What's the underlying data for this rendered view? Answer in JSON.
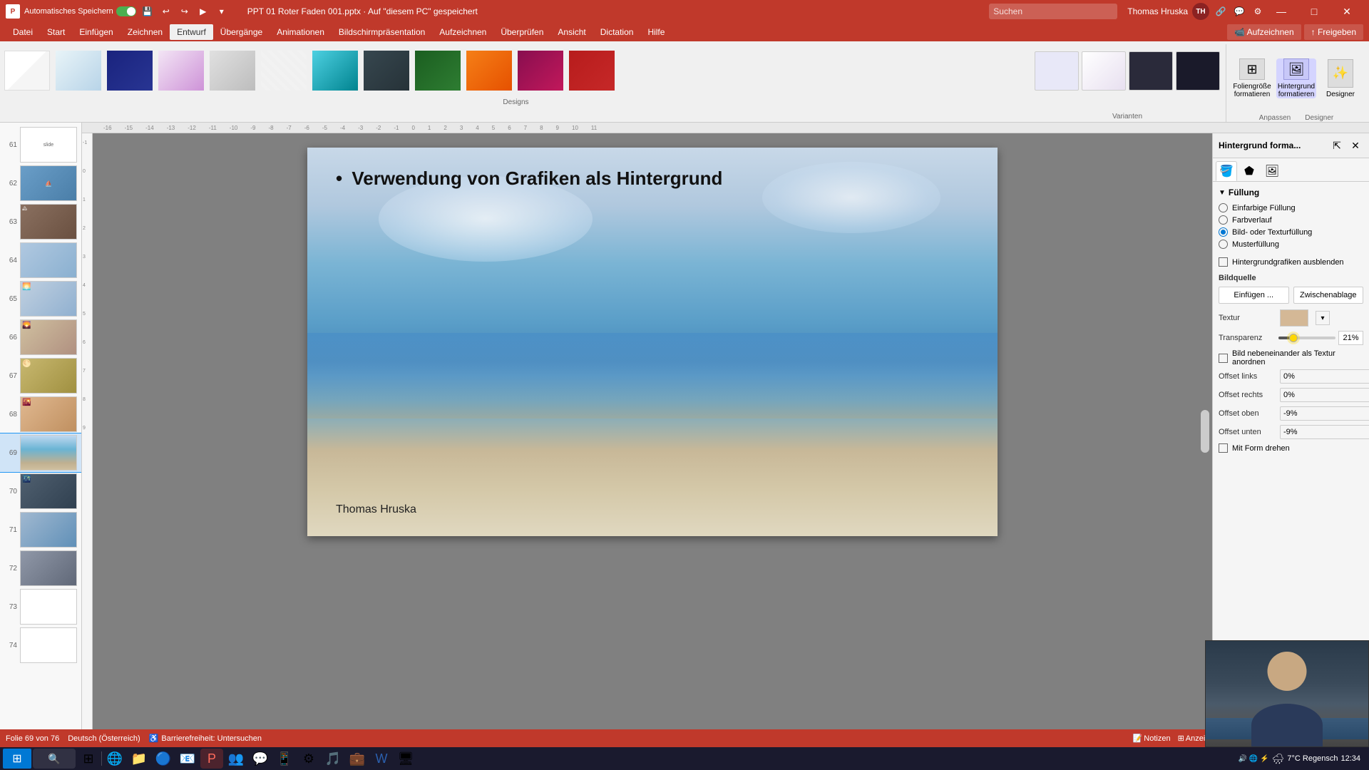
{
  "titlebar": {
    "autosave_label": "Automatisches Speichern",
    "file_name": "PPT 01 Roter Faden 001.pptx",
    "saved_label": "Auf \"diesem PC\" gespeichert",
    "user_name": "Thomas Hruska",
    "user_initials": "TH",
    "minimize": "—",
    "maximize": "□",
    "close": "✕"
  },
  "search": {
    "placeholder": "Suchen"
  },
  "menubar": {
    "items": [
      {
        "id": "datei",
        "label": "Datei"
      },
      {
        "id": "start",
        "label": "Start"
      },
      {
        "id": "einfuegen",
        "label": "Einfügen"
      },
      {
        "id": "zeichnen",
        "label": "Zeichnen"
      },
      {
        "id": "entwurf",
        "label": "Entwurf",
        "active": true
      },
      {
        "id": "uebergaenge",
        "label": "Übergänge"
      },
      {
        "id": "animationen",
        "label": "Animationen"
      },
      {
        "id": "bildschirm",
        "label": "Bildschirmpräsentation"
      },
      {
        "id": "aufzeichnen",
        "label": "Aufzeichnen"
      },
      {
        "id": "ueberpruefen",
        "label": "Überprüfen"
      },
      {
        "id": "ansicht",
        "label": "Ansicht"
      },
      {
        "id": "dictation",
        "label": "Dictation"
      },
      {
        "id": "hilfe",
        "label": "Hilfe"
      }
    ]
  },
  "ribbon": {
    "designs_label": "Designs",
    "variants_label": "Varianten",
    "aufzeichnen_btn": "Aufzeichnen",
    "freigeben_btn": "Freigeben",
    "anpassen_label": "Anpassen",
    "designer_label": "Designer",
    "foliengroesse_label": "Foliengröße formatieren",
    "hintergrund_label": "Hintergrund formatieren",
    "designer_btn": "Designer"
  },
  "slides": [
    {
      "number": "61",
      "active": false
    },
    {
      "number": "62",
      "active": false
    },
    {
      "number": "63",
      "active": false
    },
    {
      "number": "64",
      "active": false
    },
    {
      "number": "65",
      "active": false
    },
    {
      "number": "66",
      "active": false
    },
    {
      "number": "67",
      "active": false
    },
    {
      "number": "68",
      "active": false
    },
    {
      "number": "69",
      "active": true
    },
    {
      "number": "70",
      "active": false
    },
    {
      "number": "71",
      "active": false
    },
    {
      "number": "72",
      "active": false
    },
    {
      "number": "73",
      "active": false
    },
    {
      "number": "74",
      "active": false
    }
  ],
  "slide": {
    "title_text": "Verwendung von Grafiken als Hintergrund",
    "author_text": "Thomas Hruska"
  },
  "right_panel": {
    "title": "Hintergrund forma...",
    "tabs": [
      {
        "id": "fill",
        "icon": "🪣"
      },
      {
        "id": "shape",
        "icon": "⬟"
      },
      {
        "id": "image",
        "icon": "🖼"
      }
    ],
    "section_title": "Füllung",
    "fill_options": [
      {
        "id": "einfarbig",
        "label": "Einfarbige Füllung",
        "checked": false
      },
      {
        "id": "farbverlauf",
        "label": "Farbverlauf",
        "checked": false
      },
      {
        "id": "bild",
        "label": "Bild- oder Texturfüllung",
        "checked": true
      },
      {
        "id": "muster",
        "label": "Musterfüllung",
        "checked": false
      }
    ],
    "hide_bg_label": "Hintergrundgrafiken ausblenden",
    "hide_bg_checked": false,
    "bildquelle_label": "Bildquelle",
    "einfuegen_btn": "Einfügen ...",
    "zwischenablage_btn": "Zwischenablage",
    "textur_label": "Textur",
    "transparency_label": "Transparenz",
    "transparency_value": "21%",
    "tile_label": "Bild nebeneinander als Textur anordnen",
    "tile_checked": false,
    "offset_links_label": "Offset links",
    "offset_links_value": "0%",
    "offset_rechts_label": "Offset rechts",
    "offset_rechts_value": "0%",
    "offset_oben_label": "Offset oben",
    "offset_oben_value": "-9%",
    "offset_unten_label": "Offset unten",
    "offset_unten_value": "-9%",
    "mit_form_label": "Mit Form drehen"
  },
  "statusbar": {
    "slide_info": "Folie 69 von 76",
    "language": "Deutsch (Österreich)",
    "accessibility": "Barrierefreiheit: Untersuchen",
    "notizen": "Notizen",
    "anzeigeeinstellungen": "Anzeigeeinstellungen"
  },
  "taskbar": {
    "weather": "7°C  Regensch",
    "time": "12:34"
  }
}
